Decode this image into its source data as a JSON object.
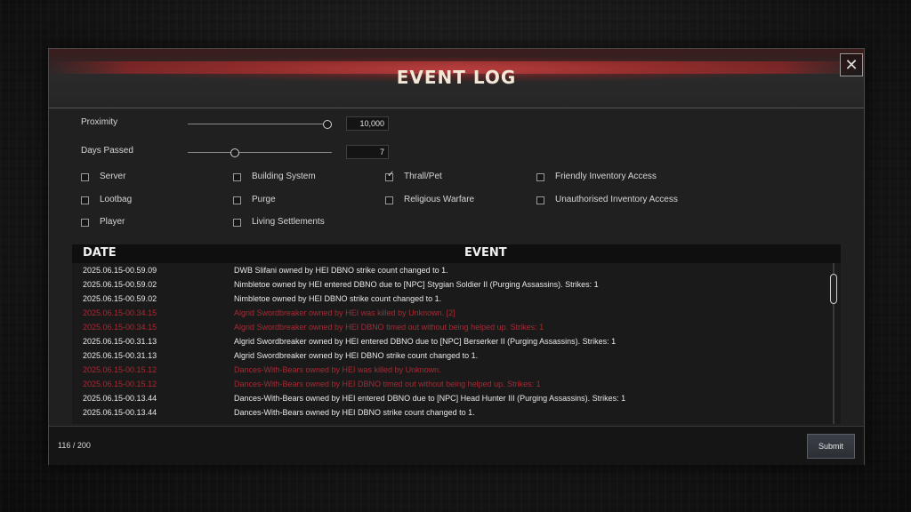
{
  "title": "EVENT LOG",
  "close_icon": "✕",
  "sliders": [
    {
      "label": "Proximity",
      "value": "10,000",
      "position": 0.97
    },
    {
      "label": "Days Passed",
      "value": "7",
      "position": 0.33
    }
  ],
  "filters": [
    {
      "label": "Server",
      "checked": false
    },
    {
      "label": "Building System",
      "checked": false
    },
    {
      "label": "Thrall/Pet",
      "checked": true
    },
    {
      "label": "Friendly Inventory Access",
      "checked": false
    },
    {
      "label": "Lootbag",
      "checked": false
    },
    {
      "label": "Purge",
      "checked": false
    },
    {
      "label": "Religious Warfare",
      "checked": false
    },
    {
      "label": "Unauthorised Inventory Access",
      "checked": false
    },
    {
      "label": "Player",
      "checked": false
    },
    {
      "label": "Living Settlements",
      "checked": false
    }
  ],
  "log": {
    "date_header": "DATE",
    "event_header": "EVENT",
    "rows": [
      {
        "date": "2025.06.15-00.59.09",
        "event": "DWB Slifani owned by HEI DBNO strike count changed to 1.",
        "type": "normal"
      },
      {
        "date": "2025.06.15-00.59.02",
        "event": "Nimbletoe owned by HEI entered DBNO due to [NPC] Stygian Soldier II (Purging Assassins).  Strikes: 1",
        "type": "normal"
      },
      {
        "date": "2025.06.15-00.59.02",
        "event": "Nimbletoe owned by HEI DBNO strike count changed to 1.",
        "type": "normal"
      },
      {
        "date": "2025.06.15-00.34.15",
        "event": "Algrid Swordbreaker owned by HEI was killed by Unknown. [2]",
        "type": "death"
      },
      {
        "date": "2025.06.15-00.34.15",
        "event": "Algrid Swordbreaker owned by HEI DBNO timed out without being helped up.  Strikes: 1",
        "type": "death"
      },
      {
        "date": "2025.06.15-00.31.13",
        "event": "Algrid Swordbreaker owned by HEI entered DBNO due to [NPC] Berserker II (Purging Assassins).  Strikes: 1",
        "type": "normal"
      },
      {
        "date": "2025.06.15-00.31.13",
        "event": "Algrid Swordbreaker owned by HEI DBNO strike count changed to 1.",
        "type": "normal"
      },
      {
        "date": "2025.06.15-00.15.12",
        "event": "Dances-With-Bears owned by HEI was killed by Unknown.",
        "type": "death"
      },
      {
        "date": "2025.06.15-00.15.12",
        "event": "Dances-With-Bears owned by HEI DBNO timed out without being helped up.  Strikes: 1",
        "type": "death"
      },
      {
        "date": "2025.06.15-00.13.44",
        "event": "Dances-With-Bears owned by HEI entered DBNO due to [NPC] Head Hunter III (Purging Assassins).  Strikes: 1",
        "type": "normal"
      },
      {
        "date": "2025.06.15-00.13.44",
        "event": "Dances-With-Bears owned by HEI DBNO strike count changed to 1.",
        "type": "normal"
      }
    ],
    "scroll_position": 0.08
  },
  "footer": {
    "count": "116 / 200",
    "submit_label": "Submit"
  },
  "colors": {
    "death_text": "#a72a35",
    "normal_text": "#e8e8e8",
    "accent_red": "#c83c3c"
  }
}
